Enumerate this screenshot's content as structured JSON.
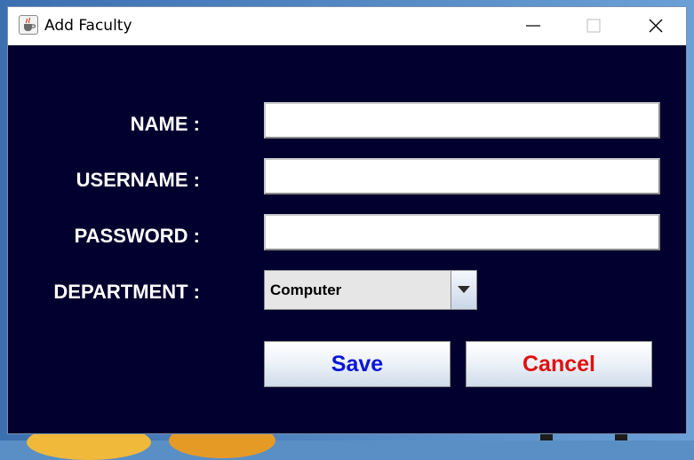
{
  "window": {
    "title": "Add Faculty",
    "app_icon": "java-cup-icon"
  },
  "form": {
    "name_label": "NAME :",
    "username_label": "USERNAME :",
    "password_label": "PASSWORD :",
    "department_label": "DEPARTMENT :",
    "name_value": "",
    "username_value": "",
    "password_value": "",
    "department_selected": "Computer"
  },
  "buttons": {
    "save_label": "Save",
    "cancel_label": "Cancel"
  },
  "colors": {
    "panel_bg": "#02002e",
    "save_text": "#0b16d9",
    "cancel_text": "#e01010"
  }
}
